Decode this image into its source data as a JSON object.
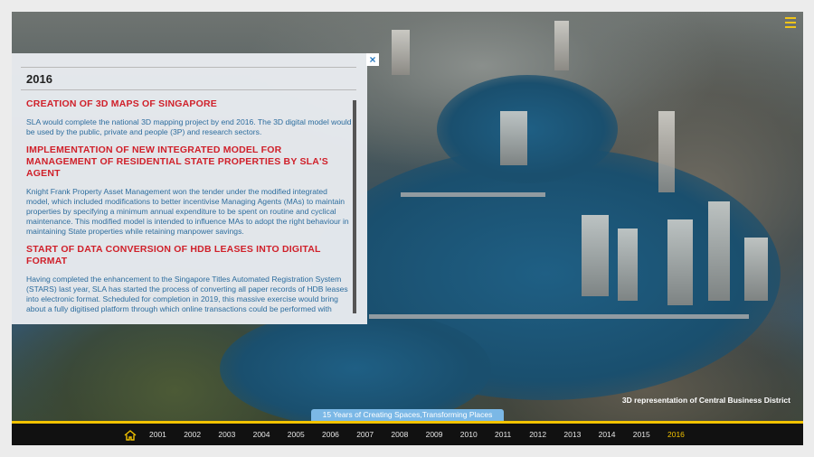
{
  "panel": {
    "year": "2016",
    "sections": [
      {
        "heading": "CREATION OF 3D MAPS OF SINGAPORE",
        "body": "SLA would complete the national 3D mapping project by end 2016. The 3D digital model would be used by the public, private and people (3P) and research sectors."
      },
      {
        "heading": "IMPLEMENTATION OF NEW INTEGRATED MODEL FOR MANAGEMENT OF RESIDENTIAL STATE PROPERTIES BY SLA'S AGENT",
        "body": "Knight Frank Property Asset Management won the tender under the modified integrated model, which included modifications to better incentivise Managing Agents (MAs) to maintain properties by specifying a minimum annual expenditure to be spent on routine and cyclical maintenance. This modified model is intended to influence MAs to adopt the right behaviour in maintaining State properties while retaining manpower savings."
      },
      {
        "heading": "START OF DATA CONVERSION OF HDB LEASES INTO DIGITAL FORMAT",
        "body": "Having completed the enhancement to the Singapore Titles Automated Registration System (STARS) last year, SLA has started the process of converting all paper records of HDB leases into electronic format. Scheduled for completion in 2019, this massive exercise would bring about a fully digitised platform through which online transactions could be performed with greater ease in the future."
      }
    ],
    "close_glyph": "×"
  },
  "caption": "3D representation of Central Business District",
  "tagline": "15 Years of Creating Spaces,Transforming Places",
  "timeline": {
    "years": [
      "2001",
      "2002",
      "2003",
      "2004",
      "2005",
      "2006",
      "2007",
      "2008",
      "2009",
      "2010",
      "2011",
      "2012",
      "2013",
      "2014",
      "2015",
      "2016"
    ],
    "active": "2016"
  },
  "colors": {
    "accent": "#f2c300",
    "heading_red": "#d0202a",
    "body_blue": "#2d6d9e",
    "tagline_bg": "#7bb8e6"
  },
  "icons": [
    "menu-icon",
    "close-icon",
    "home-icon"
  ]
}
